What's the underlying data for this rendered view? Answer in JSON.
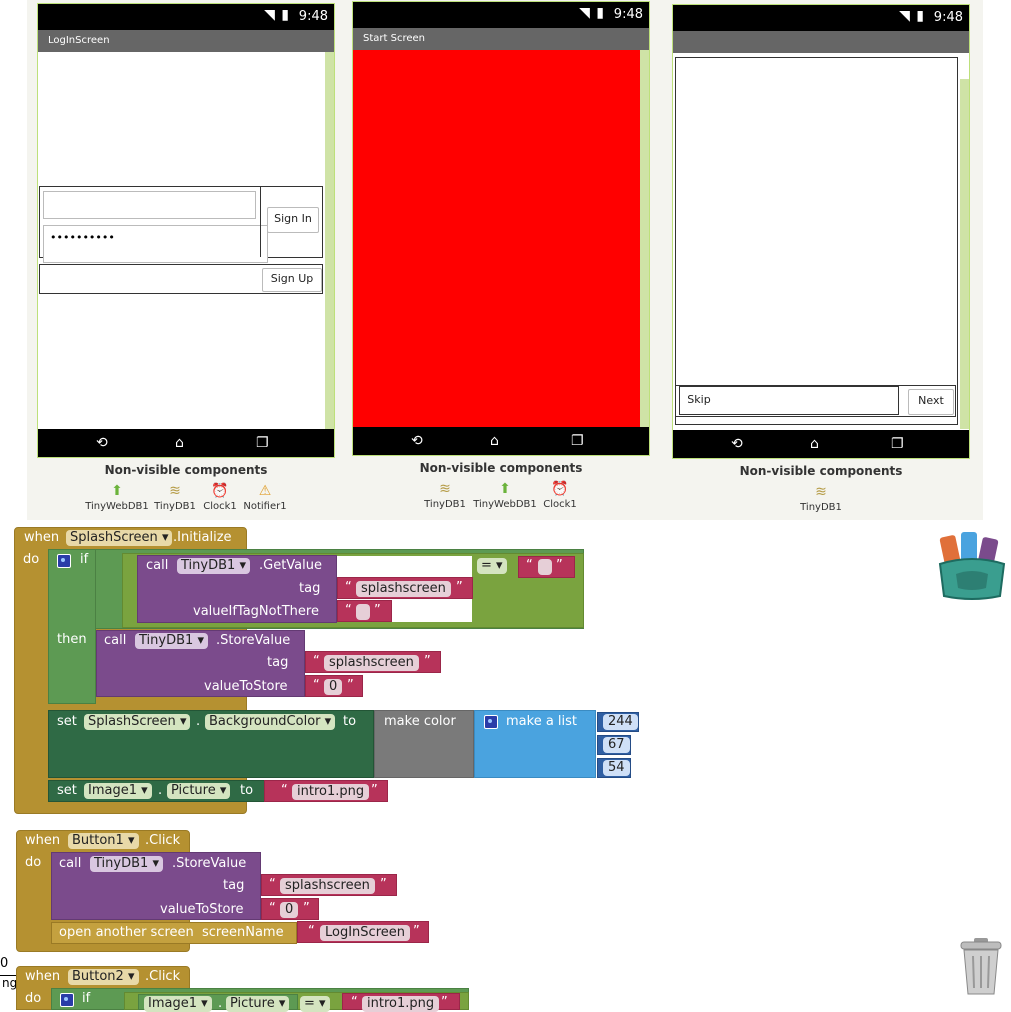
{
  "phones": [
    {
      "title": "LogInScreen",
      "time": "9:48",
      "password_value": "••••••••••",
      "sign_in_label": "Sign In",
      "sign_up_label": "Sign Up"
    },
    {
      "title": "Start Screen",
      "time": "9:48",
      "background_color": "#ff0000"
    },
    {
      "title": "",
      "time": "9:48",
      "skip_label": "Skip",
      "next_label": "Next"
    }
  ],
  "nonvisible_title": "Non-visible components",
  "nonvisible": [
    [
      "TinyWebDB1",
      "TinyDB1",
      "Clock1",
      "Notifier1"
    ],
    [
      "TinyDB1",
      "TinyWebDB1",
      "Clock1"
    ],
    [
      "TinyDB1"
    ]
  ],
  "blocks": {
    "b1": {
      "when": "when",
      "component": "SplashScreen",
      "event": ".Initialize",
      "do": "do",
      "if": "if",
      "call": "call",
      "db": "TinyDB1",
      "getvalue": ".GetValue",
      "tag_lbl": "tag",
      "tag_val": "splashscreen",
      "viftnt": "valueIfTagNotThere",
      "eq": "=",
      "then": "then",
      "storevalue": ".StoreValue",
      "valuetostore": "valueToStore",
      "zero": "0",
      "set": "set",
      "bgcolor": "BackgroundColor",
      "to": "to",
      "makecolor": "make color",
      "makelist": "make a list",
      "r": "244",
      "g": "67",
      "b": "54",
      "image": "Image1",
      "picture": "Picture",
      "dot": ".",
      "intro": "intro1.png"
    },
    "b2": {
      "when": "when",
      "component": "Button1",
      "event": ".Click",
      "do": "do",
      "call": "call",
      "db": "TinyDB1",
      "storevalue": ".StoreValue",
      "tag_lbl": "tag",
      "tag_val": "splashscreen",
      "valuetostore": "valueToStore",
      "zero": "0",
      "open": "open another screen",
      "screenname": "screenName",
      "screen_val": "LogInScreen"
    },
    "b3": {
      "when": "when",
      "component": "Button2",
      "event": ".Click",
      "do": "do",
      "if": "if",
      "image": "Image1",
      "picture": "Picture",
      "dot": ".",
      "eq": "=",
      "intro": "intro1.png"
    }
  },
  "edge_fragments": [
    "0",
    "ngs"
  ],
  "dropdown_arrow": "▾",
  "open_quote": "“",
  "close_quote": "”"
}
